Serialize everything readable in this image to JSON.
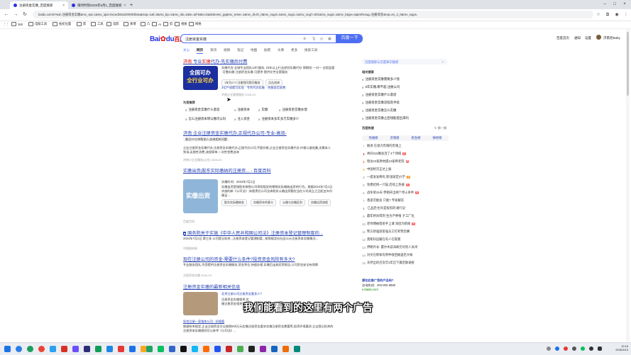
{
  "browser": {
    "tabs": [
      {
        "title": "注册资金实缴_百度搜索"
      },
      {
        "title": "限时时刻2025年5月1_百度搜索"
      }
    ],
    "url": "baidu.com/s?wd=注册资金实缴&rsv_spt=1&rsv_iqid=0xced20a4200003b4a&issp=1&f=3&rsv_bp=1&rsv_idx=2&ie=utf-8&tn=baiduhome_pg&rsv_enter=1&rsv_dl=th_0&rsv_sug3=1&rsv_sug1=1&rsv_sug7=001&rsv_sug2=1&rsv_btype=i&prefixsug=注册资金&rsp=es_2_0&rsv_sug4=",
    "bookmarks": [
      "360",
      "电脑工具",
      "拓初位置",
      "影",
      "工具",
      "电影",
      "黄博",
      "凸",
      "AI",
      "剪",
      "相册",
      "网络"
    ]
  },
  "baidu": {
    "logo_a": "Bai",
    "logo_b": "du",
    "logo_c": "百度",
    "query": "注册资金实缴",
    "search_button": "百度一下",
    "top_links": [
      "百度首页",
      "通知",
      "设置",
      "济南老Baby"
    ],
    "tabs": [
      "文心",
      "网页",
      "资讯",
      "视频",
      "笔记",
      "地图",
      "贴吧",
      "文库",
      "更多",
      "搜索工具"
    ]
  },
  "results": {
    "ad1": {
      "title_a": "济南",
      "title_b": "专业",
      "title_c": "实缴",
      "title_d": "代办-先实缴后付费",
      "snippet": "实缴代办 全城专业团队13行服务, 15年以上行业经验实缴代办·周期短·一对一·全程监管·可靠实缴·注册资金实缴·可提供 提供文件全套服务",
      "img_lines": [
        "全国可办",
        "全行业可办"
      ],
      "btns": [
        "1年为27人注册我司我司服务",
        "点击咨询",
        "3亿户成就可实现",
        "专利代办实缴",
        "先服务后收费"
      ],
      "meta": "济南企业管理服务 2026-03"
    },
    "related_label": "为您推荐",
    "recommend": [
      "注册资金实缴什么意思",
      "注册资本",
      "实缴",
      "注册资金实缴办理",
      "怎么注册资本转认缴可以吗",
      "注入资金",
      "注册资本多年多万实缴多少"
    ],
    "r2": {
      "title": "济南 企业注册资金实缴代办,正规代办公司-专业-高效-",
      "sub": "最近47分钟帮助人咨询相关问题",
      "snippet": "企业注册资金实缴代办,注册资金实缴代办,正规代办公司,不超价格,企业注册资金实缴代办 价格公道低廉,无需本人到场,无隐性消费,流程简单,一次性免费咨询",
      "meta": "济南小企业服务(山东) 2026-03"
    },
    "r3": {
      "title": "实缴出资|股东实际缴纳的注册资... - 百度百科",
      "snippet_a": "实缴时间：2024年7月1日",
      "snippet_b": "实缴出资是指股东按照公司章程规定的期限实际缴纳出资的行为。根据2024年7月1日实施的新《公司法》,有限责任公司全体股东认缴出资额应当在公司成立之日起五年内缴足...",
      "img_text": "实缴出资",
      "btns": [
        "股东实际缴纳金",
        "实缴资本的意义",
        "认缴与实缴区别",
        "实缴出资流程"
      ],
      "meta": "百度百科"
    },
    "r4": {
      "title": "国务院关于实施《中华人民共和国公司法》注册资本登记管理制度的...",
      "snippet": "2024年7月1日 第三条 公司登记机关...注册资本登记管理制度...按照规定向社会公示注册资本实缴情况...",
      "meta": "中国政府网"
    },
    "r5": {
      "title": "现在注册公司的资金-需要什么条件?投资资金风险有多大?",
      "snippet": "专业服务团队,为您提供注册资金实缴服务,资金到位,快速办理,实缴后出具验资报告,公司资金安全有保障",
      "meta": "注册资金实缴 2026-03"
    },
    "r6": {
      "title": "注册资金实缴的最新相关信息",
      "news": "北京注册公司注册资金要多少?",
      "news_sub": "注册资金实缴相关,实缴注册资金相关信息",
      "bottom_title": "如何注册一家电车公司 - 好搜狐",
      "bottom_snip": "根据有关规定,企业注册资金可以按照500万元实缴注册资金要求实缴注册资金需要等,投资环境要求,企业登记机关的注册资本实缴规则可以参考《公司法》..."
    }
  },
  "sidebar": {
    "wenxin": "百度搜索与百度知识搜索",
    "related_title": "相关搜索",
    "related": [
      "注册资金实缴需要多少钱",
      "5年实缴,哪不超,注册公司",
      "注册资金实缴什么意思",
      "注册资金实缴流程及手续",
      "注册资金实缴怎么实缴",
      "注册资金实缴之后钱能提出来吗"
    ],
    "hot_title": "百度热搜",
    "hot_more": "换一换",
    "chips": [
      "热搜榜",
      "济南榜",
      "民生榜",
      "财经榜"
    ],
    "hot": [
      {
        "n": "",
        "t": "推进 在接力奔跑的奔驰上",
        "b": ""
      },
      {
        "n": "1",
        "t": "共同315晚会连了4个领域",
        "b": "热"
      },
      {
        "n": "2",
        "t": "暗访10家原材提10家养老院",
        "b": "热"
      },
      {
        "n": "3",
        "t": "中国经济正达上振",
        "b": ""
      },
      {
        "n": "4",
        "t": "一提发发稀有,新'国家定价学'",
        "b": "新"
      },
      {
        "n": "5",
        "t": "免费结例一只猫 后续上热搜",
        "b": "热"
      },
      {
        "n": "6",
        "t": "战争第15天 伊朗开出两个停火条件",
        "b": "热"
      },
      {
        "n": "7",
        "t": "香菜可能会 只能? 专家解答",
        "b": ""
      },
      {
        "n": "8",
        "t": "'乙品后'也许是按剪的'通行证'",
        "b": ""
      },
      {
        "n": "9",
        "t": "最年终尚得到 生为产养殖 子工厂化",
        "b": ""
      },
      {
        "n": "10",
        "t": "老师傅被借泉手上课 添因为新闻",
        "b": "热"
      },
      {
        "n": "11",
        "t": "警方新强游客强员工打死警后赛",
        "b": ""
      },
      {
        "n": "12",
        "t": "莫斯科运输在有人在夜袭",
        "b": ""
      },
      {
        "n": "13",
        "t": "伊朗外长: 霍尔木兹海峡仍对别人关闭",
        "b": ""
      },
      {
        "n": "14",
        "t": "对文在称家有原件收回被盗后大帐",
        "b": ""
      },
      {
        "n": "15",
        "t": "天然出的百货可1年迈下属后散调查",
        "b": ""
      }
    ],
    "promo_title": "想在此推广您的产品吗?",
    "promo_phone": "咨询热线：400-800-8888",
    "promo_site": "e.baidu.com"
  },
  "overlay": {
    "subtitle": "我们能看到的这里有两个广告"
  },
  "system": {
    "time": "10:16",
    "date": "2026/3/13"
  }
}
